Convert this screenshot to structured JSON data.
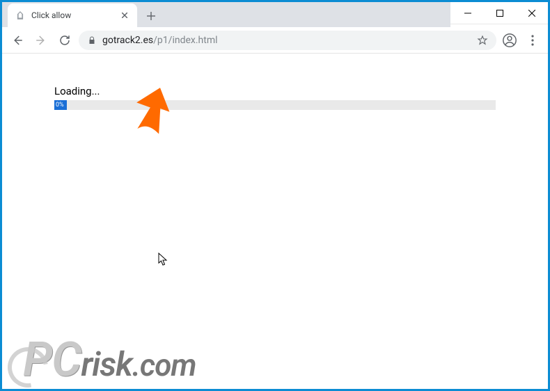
{
  "window": {
    "minimize_label": "Minimize",
    "maximize_label": "Maximize",
    "close_label": "Close"
  },
  "tab": {
    "title": "Click allow",
    "close_label": "Close tab"
  },
  "newtab_label": "New tab",
  "toolbar": {
    "back_label": "Back",
    "forward_label": "Forward",
    "reload_label": "Reload",
    "lock_label": "Secure",
    "url_host": "gotrack2.es",
    "url_path": "/p1/index.html",
    "star_label": "Bookmark this page",
    "avatar_label": "You",
    "menu_label": "Customize and control"
  },
  "page": {
    "loading_text": "Loading...",
    "progress_percent": "0%"
  },
  "watermark": {
    "part1": "PC",
    "part2": "risk",
    "part3": ".com"
  }
}
